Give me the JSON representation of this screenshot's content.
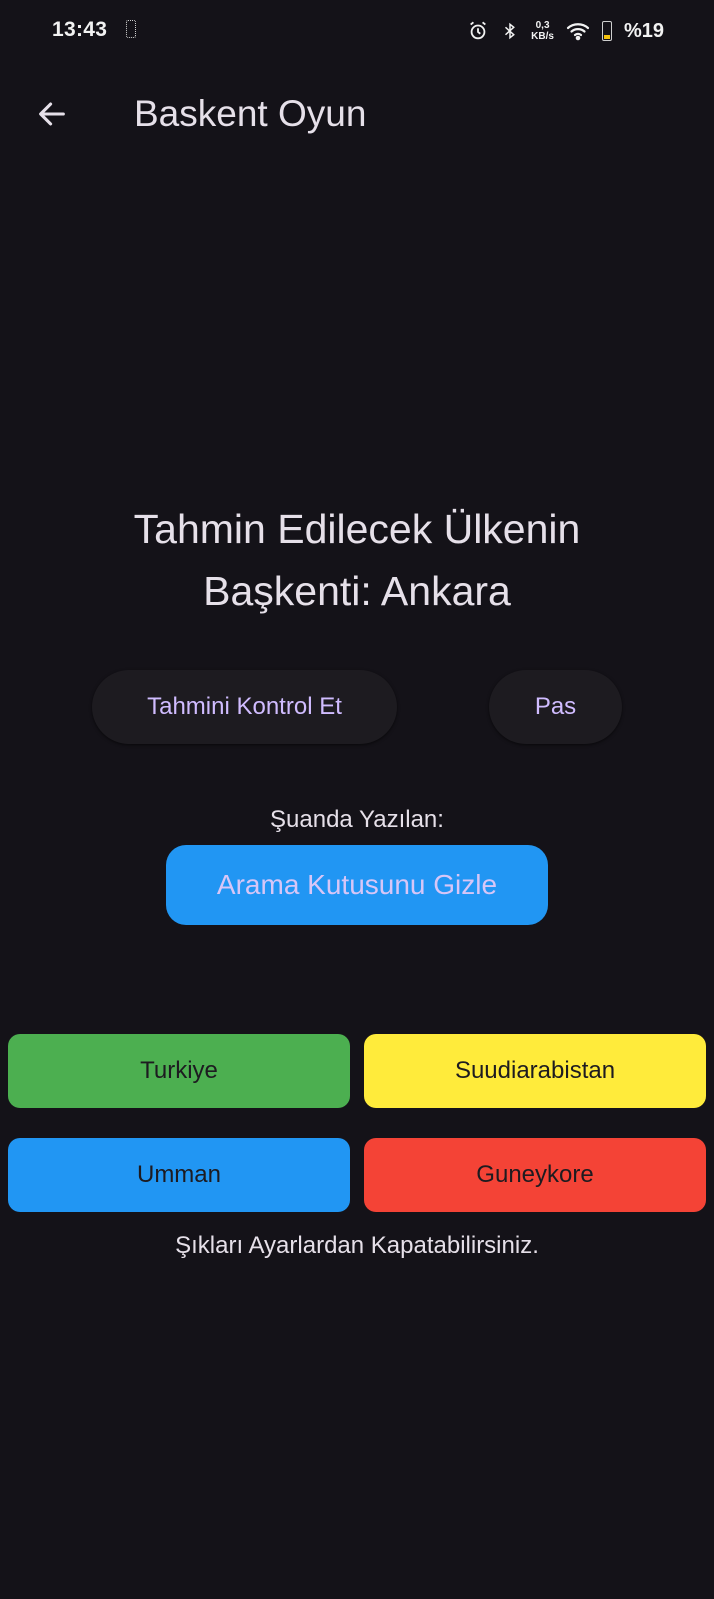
{
  "status_bar": {
    "time": "13:43",
    "net_speed_value": "0,3",
    "net_speed_unit": "KB/s",
    "battery_text": "%19",
    "icons": [
      "vibrate-icon",
      "alarm-icon",
      "bluetooth-icon",
      "wifi-icon",
      "battery-icon"
    ]
  },
  "app_bar": {
    "title": "Baskent Oyun",
    "back_icon": "arrow-back-icon"
  },
  "question": {
    "line1": "Tahmin Edilecek Ülkenin",
    "line2": "Başkenti: Ankara"
  },
  "actions": {
    "check_label": "Tahmini Kontrol Et",
    "pass_label": "Pas"
  },
  "current": {
    "label": "Şuanda Yazılan:",
    "hide_search_label": "Arama Kutusunu Gizle"
  },
  "options": [
    {
      "label": "Turkiye",
      "color": "#4caf50"
    },
    {
      "label": "Suudiarabistan",
      "color": "#ffeb3b"
    },
    {
      "label": "Umman",
      "color": "#2196f3"
    },
    {
      "label": "Guneykore",
      "color": "#f44336"
    }
  ],
  "footer_note": "Şıkları Ayarlardan Kapatabilirsiniz.",
  "colors": {
    "background": "#141218",
    "primary_text": "#e6e0e9",
    "accent": "#d0bcff",
    "blue": "#2196f3"
  }
}
